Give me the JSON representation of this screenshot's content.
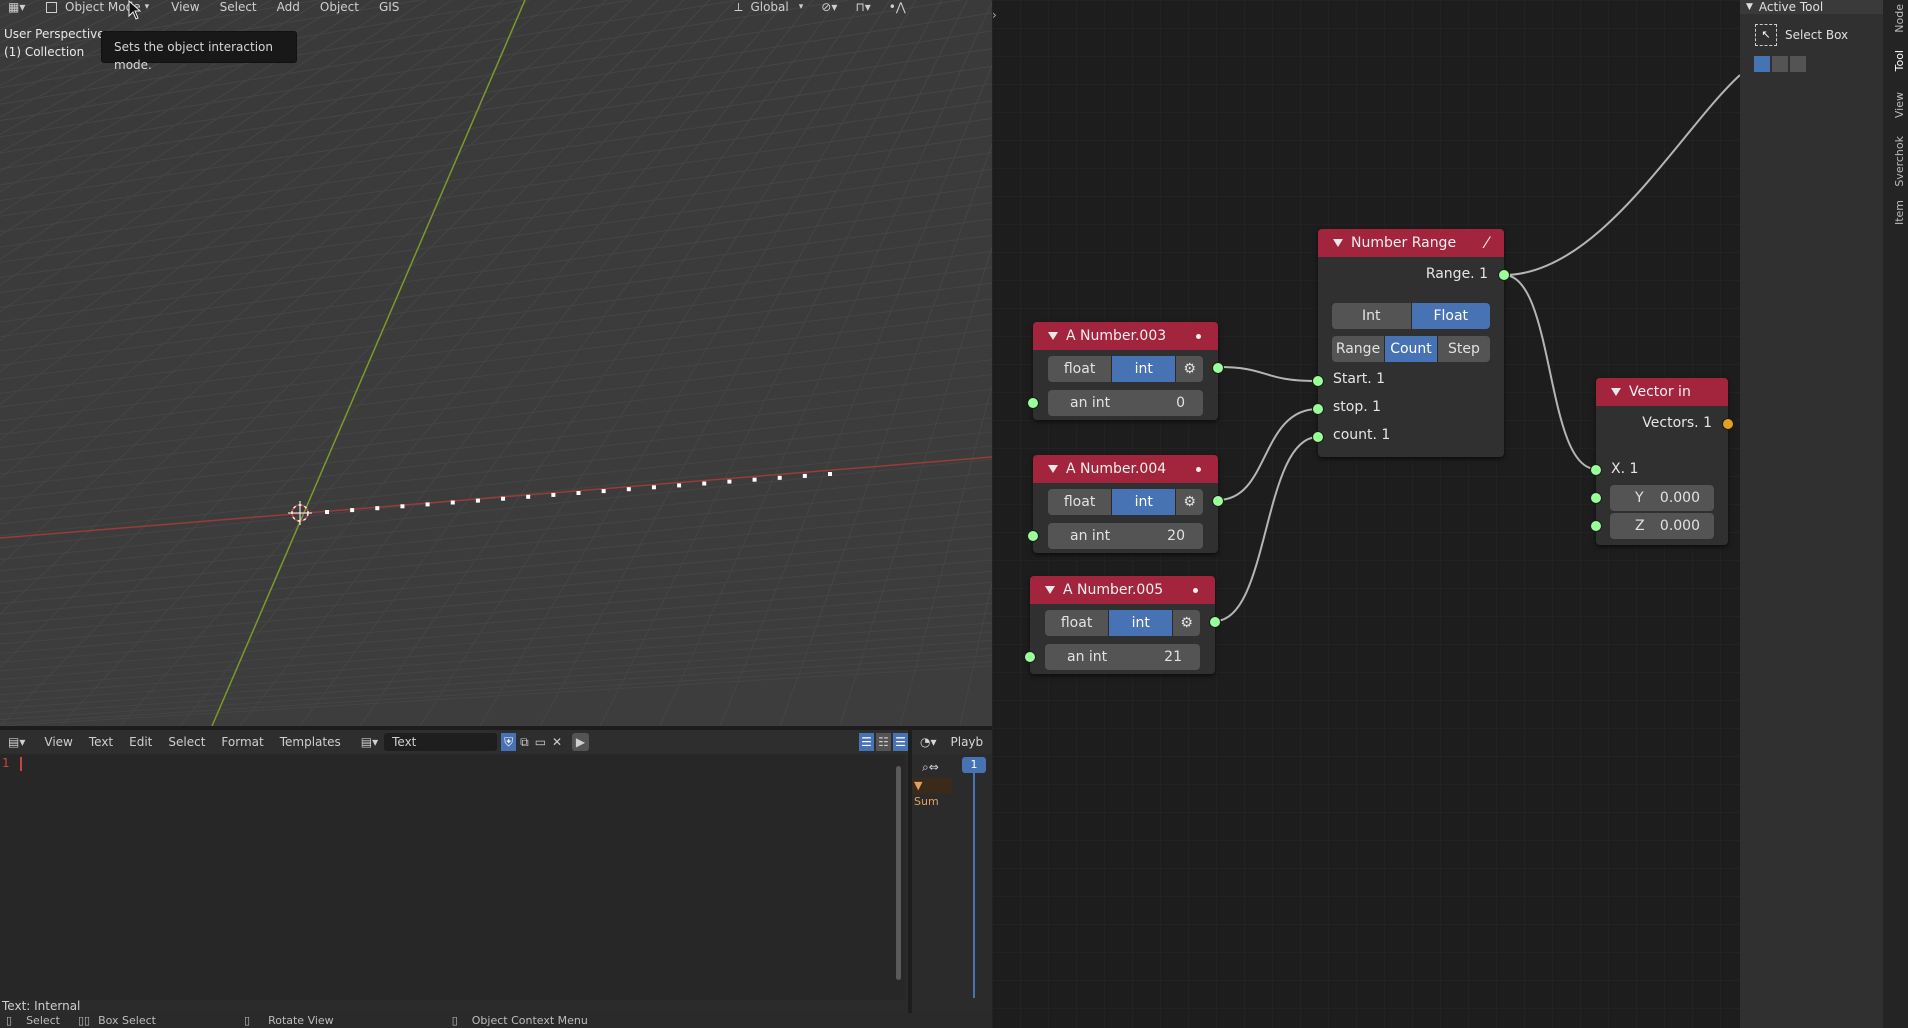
{
  "viewport": {
    "header": {
      "mode": "Object Mode",
      "menus": [
        "View",
        "Select",
        "Add",
        "Object",
        "GIS"
      ],
      "orientation": "Global"
    },
    "overlay": {
      "perspective": "User Perspective",
      "collection": "(1) Collection"
    },
    "tooltip": "Sets the object interaction mode."
  },
  "text_editor": {
    "menus": [
      "View",
      "Text",
      "Edit",
      "Select",
      "Format",
      "Templates"
    ],
    "datablock": "Text",
    "line_number": "1",
    "status": "Text: Internal"
  },
  "timeline": {
    "menu": "Playb",
    "summary": "Sum",
    "frame": "1"
  },
  "status_bar": {
    "select": "Select",
    "box_select": "Box Select",
    "rotate_view": "Rotate View",
    "context_menu": "Object Context Menu"
  },
  "sidebar": {
    "section": "Active Tool",
    "tool_name": "Select Box",
    "tabs": [
      "Node",
      "Tool",
      "View",
      "Sverchok",
      "Item"
    ]
  },
  "nodes": {
    "number_003": {
      "title": "A Number.003",
      "opt_a": "float",
      "opt_b": "int",
      "field_label": "an int",
      "field_value": "0"
    },
    "number_004": {
      "title": "A Number.004",
      "opt_a": "float",
      "opt_b": "int",
      "field_label": "an int",
      "field_value": "20"
    },
    "number_005": {
      "title": "A Number.005",
      "opt_a": "float",
      "opt_b": "int",
      "field_label": "an int",
      "field_value": "21"
    },
    "number_range": {
      "title": "Number Range",
      "output": "Range. 1",
      "type_a": "Int",
      "type_b": "Float",
      "mode_a": "Range",
      "mode_b": "Count",
      "mode_c": "Step",
      "in_start": "Start. 1",
      "in_stop": "stop. 1",
      "in_count": "count. 1"
    },
    "vector_in": {
      "title": "Vector in",
      "output": "Vectors. 1",
      "in_x": "X. 1",
      "y_label": "Y",
      "y_value": "0.000",
      "z_label": "Z",
      "z_value": "0.000"
    }
  },
  "colors": {
    "node_header": "#a3243d",
    "active_button": "#4772b3",
    "socket_float": "#99ff99",
    "socket_vector": "#e6a020"
  }
}
